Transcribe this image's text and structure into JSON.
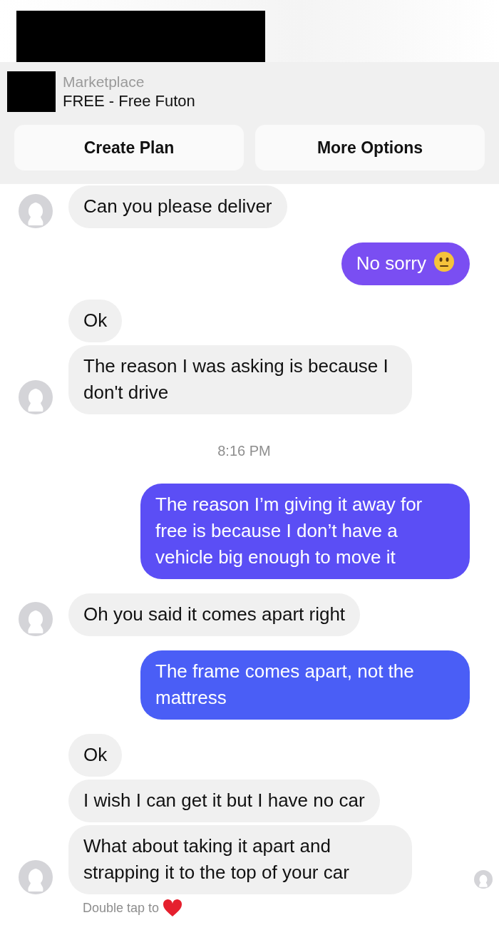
{
  "listing": {
    "category": "Marketplace",
    "title": "FREE - Free Futon"
  },
  "actions": [
    "Create Plan",
    "More Options"
  ],
  "messages": [
    {
      "kind": "incoming",
      "text": "Can you please deliver"
    },
    {
      "kind": "outgoing",
      "text": "No sorry",
      "emoji": true,
      "color": "#7a4ef2"
    },
    {
      "kind": "incoming",
      "text": "Ok"
    },
    {
      "kind": "incoming",
      "text": "The reason I was asking is because I don't drive"
    },
    {
      "kind": "timestamp",
      "text": "8:16 PM"
    },
    {
      "kind": "outgoing",
      "text": "The reason I’m giving it away for free is because I don’t have a vehicle big enough to move it",
      "color": "#5b4ef5"
    },
    {
      "kind": "incoming",
      "text": "Oh  you said it comes apart right"
    },
    {
      "kind": "outgoing",
      "text": "The frame comes apart, not the mattress",
      "color": "#4a5ef6"
    },
    {
      "kind": "incoming",
      "text": "Ok"
    },
    {
      "kind": "incoming",
      "text": "I wish I can get it but I have no car"
    },
    {
      "kind": "incoming",
      "text": "What about taking it apart and strapping it to the top of your car",
      "seen": true
    }
  ],
  "reaction_hint": "Double tap to"
}
